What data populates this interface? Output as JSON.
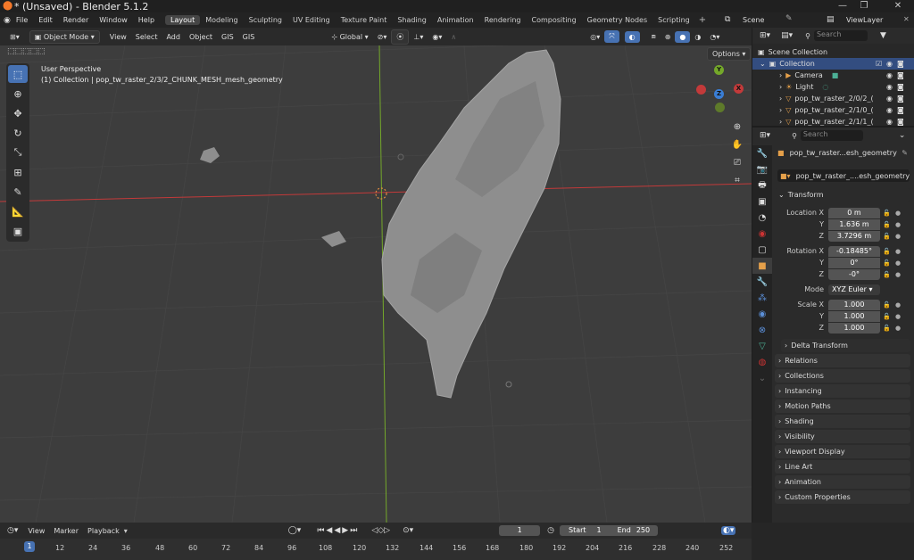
{
  "window": {
    "title": "* (Unsaved) - Blender 5.1.2"
  },
  "menu": [
    "File",
    "Edit",
    "Render",
    "Window",
    "Help"
  ],
  "workspaces": [
    "Layout",
    "Modeling",
    "Sculpting",
    "UV Editing",
    "Texture Paint",
    "Shading",
    "Animation",
    "Rendering",
    "Compositing",
    "Geometry Nodes",
    "Scripting"
  ],
  "active_workspace": "Layout",
  "scene": {
    "name": "Scene",
    "view_layer": "ViewLayer"
  },
  "viewport_header": {
    "mode": "Object Mode",
    "menus": [
      "View",
      "Select",
      "Add",
      "Object",
      "GIS",
      "GIS"
    ],
    "orientation": "Global",
    "options": "Options"
  },
  "viewport": {
    "perspective": "User Perspective",
    "collection_info": "(1) Collection | pop_tw_raster_2/3/2_CHUNK_MESH_mesh_geometry"
  },
  "gizmo": {
    "y": "Y",
    "x": "X",
    "z": "Z"
  },
  "outliner": {
    "search_placeholder": "Search",
    "scene_collection": "Scene Collection",
    "collection": "Collection",
    "items": [
      "Camera",
      "Light",
      "pop_tw_raster_2/0/2_(",
      "pop_tw_raster_2/1/0_(",
      "pop_tw_raster_2/1/1_("
    ]
  },
  "properties": {
    "search_placeholder": "Search",
    "object_name": "pop_tw_raster...esh_geometry",
    "object_datablock": "pop_tw_raster_....esh_geometry",
    "transform_label": "Transform",
    "location": {
      "label": "Location X",
      "y_label": "Y",
      "z_label": "Z",
      "x": "0 m",
      "y": "1.636 m",
      "z": "3.7296 m"
    },
    "rotation": {
      "label": "Rotation X",
      "y_label": "Y",
      "z_label": "Z",
      "x": "-0.18485°",
      "y": "0°",
      "z": "-0°"
    },
    "mode": {
      "label": "Mode",
      "value": "XYZ Euler"
    },
    "scale": {
      "label": "Scale X",
      "y_label": "Y",
      "z_label": "Z",
      "x": "1.000",
      "y": "1.000",
      "z": "1.000"
    },
    "delta_transform": "Delta Transform",
    "panels": [
      "Relations",
      "Collections",
      "Instancing",
      "Motion Paths",
      "Shading",
      "Visibility",
      "Viewport Display",
      "Line Art",
      "Animation",
      "Custom Properties"
    ]
  },
  "timeline": {
    "menus": [
      "View",
      "Marker",
      "Playback"
    ],
    "current_frame": "1",
    "start_label": "Start",
    "start": "1",
    "end_label": "End",
    "end": "250",
    "frames": [
      "1",
      "12",
      "24",
      "36",
      "48",
      "60",
      "72",
      "84",
      "96",
      "108",
      "120",
      "132",
      "144",
      "156",
      "168",
      "180",
      "192",
      "204",
      "216",
      "228",
      "240",
      "252"
    ]
  },
  "colors": {
    "accent": "#4772b3",
    "x_axis": "#c33a3a",
    "y_axis": "#74a82a",
    "z_axis": "#3a7ed6",
    "mesh": "#9a9a9a"
  }
}
